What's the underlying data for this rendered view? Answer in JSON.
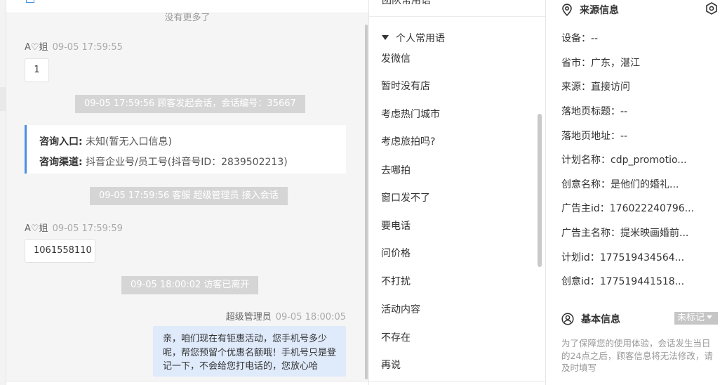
{
  "chat": {
    "no_more": "没有更多了",
    "messages": [
      {
        "sender": "A♡姐",
        "time": "09-05 17:59:55",
        "text": "1"
      },
      {
        "system": "09-05 17:59:56 顾客发起会话，会话编号：35667"
      },
      {
        "entry_label": "咨询入口:",
        "entry_value": "未知(暂无入口信息)",
        "channel_label": "咨询渠道:",
        "channel_value": "抖音企业号/员工号(抖音号ID：2839502213)"
      },
      {
        "system": "09-05 17:59:56 客服 超级管理员 接入会话"
      },
      {
        "sender": "A♡姐",
        "time": "09-05 17:59:59",
        "text": "1061558110"
      },
      {
        "system": "09-05 18:00:02 访客已离开"
      },
      {
        "sender": "超级管理员",
        "time": "09-05 18:00:05",
        "text": "亲，咱们现在有钜惠活动，您手机号多少呢，帮您预留个优惠名额哦！手机号只是登记一下，不会给您打电话的，您放心哈"
      }
    ]
  },
  "phrases": {
    "top_cut": "团队常用语",
    "group_title": "个人常用语",
    "items": [
      "发微信",
      "暂时没有店",
      "考虑热门城市",
      "考虑旅拍吗?",
      "去哪拍",
      "窗口发不了",
      "要电话",
      "问价格",
      "不打扰",
      "活动内容",
      "不存在",
      "再说"
    ]
  },
  "source": {
    "title": "来源信息",
    "rows": [
      "设备：--",
      "省市：广东，湛江",
      "来源：直接访问",
      "落地页标题：--",
      "落地页地址：--",
      "计划名称：cdp_promotio...",
      "创意名称：是他们的婚礼...",
      "广告主id：176022240796...",
      "广告主名称：提米映画婚前...",
      "计划id：177519434564...",
      "创意id：177519441518..."
    ],
    "basic_title": "基本信息",
    "tag_label": "未标记",
    "note": "为了保障您的使用体验，会话发生当日的24点之后，顾客信息将无法修改，请及时填写"
  },
  "colors": {
    "accent": "#4a90e2",
    "bubble_out": "#dfeafb",
    "system_msg": "#d5d5d5"
  }
}
